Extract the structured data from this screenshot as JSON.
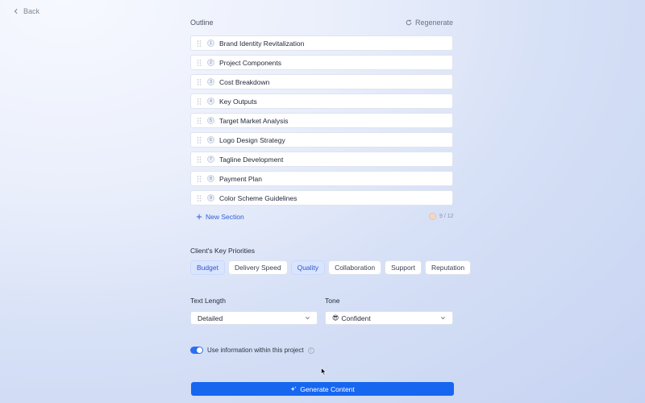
{
  "nav": {
    "back_label": "Back"
  },
  "outline": {
    "title": "Outline",
    "regenerate_label": "Regenerate",
    "items": [
      {
        "num": "1",
        "label": "Brand Identity Revitalization"
      },
      {
        "num": "2",
        "label": "Project Components"
      },
      {
        "num": "3",
        "label": "Cost Breakdown"
      },
      {
        "num": "4",
        "label": "Key Outputs"
      },
      {
        "num": "5",
        "label": "Target Market Analysis"
      },
      {
        "num": "6",
        "label": "Logo Design Strategy"
      },
      {
        "num": "7",
        "label": "Tagline Development"
      },
      {
        "num": "8",
        "label": "Payment Plan"
      },
      {
        "num": "9",
        "label": "Color Scheme Guidelines"
      }
    ],
    "new_section_label": "New Section",
    "count_label": "9 / 12"
  },
  "priorities": {
    "title": "Client's Key Priorities",
    "chips": [
      {
        "label": "Budget",
        "selected": true
      },
      {
        "label": "Delivery Speed",
        "selected": false
      },
      {
        "label": "Quality",
        "selected": true
      },
      {
        "label": "Collaboration",
        "selected": false
      },
      {
        "label": "Support",
        "selected": false
      },
      {
        "label": "Reputation",
        "selected": false
      }
    ]
  },
  "text_length": {
    "label": "Text Length",
    "value": "Detailed"
  },
  "tone": {
    "label": "Tone",
    "emoji": "😎",
    "value": "Confident"
  },
  "project_info": {
    "label": "Use information within this project",
    "enabled": true
  },
  "generate": {
    "label": "Generate Content"
  },
  "colors": {
    "accent": "#1766f0",
    "chip_selected_bg": "#d9e4ff",
    "toggle_on": "#2b6ef2"
  }
}
